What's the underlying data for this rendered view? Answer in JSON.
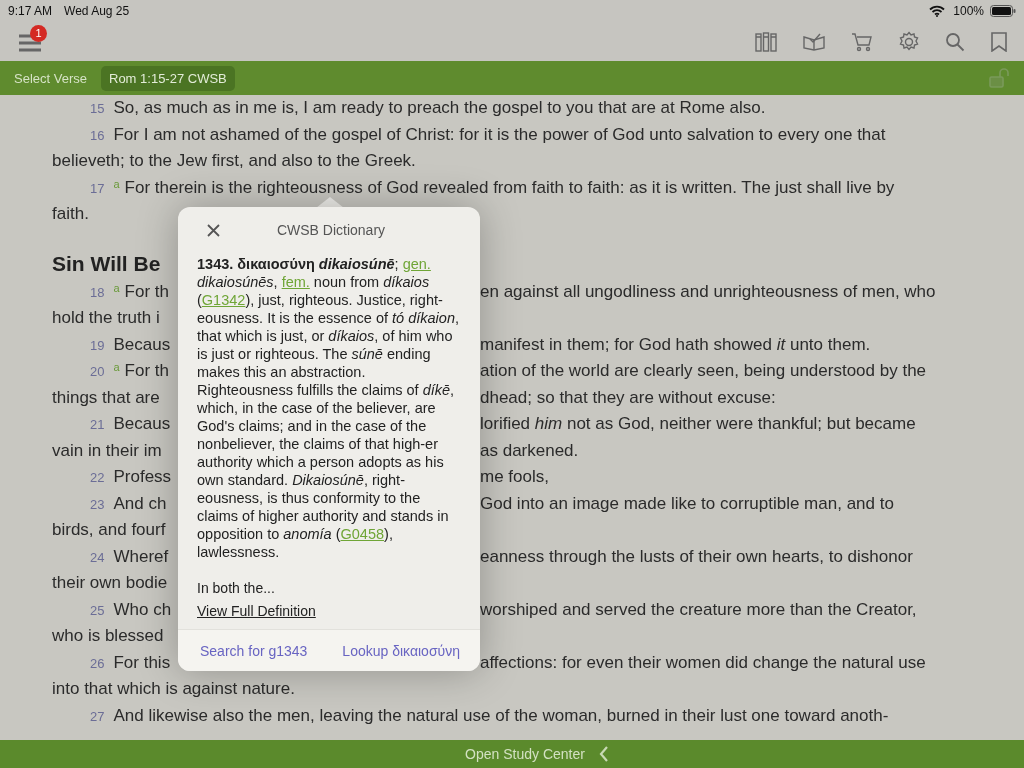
{
  "status_bar": {
    "time": "9:17 AM",
    "date": "Wed Aug 25",
    "battery": "100%"
  },
  "toolbar": {
    "menu_badge": "1"
  },
  "verse_bar": {
    "label": "Select Verse",
    "reference": "Rom 1:15-27 CWSB",
    "locked": false
  },
  "passage": [
    {
      "kind": "verse",
      "verse": "15",
      "text": "So, as much as in me is, I am ready to preach the gospel to you that are at Rome also."
    },
    {
      "kind": "verse",
      "verse": "16",
      "text": "For I am not ashamed of the gospel of Christ: for it is the power of God unto salvation to every one that"
    },
    {
      "kind": "cont",
      "text": "believeth; to the Jew first, and also to the Greek."
    },
    {
      "kind": "verse",
      "verse": "17",
      "note": "a",
      "text": "For therein is the righteousness of God revealed from faith to faith: as it is written. The just shall live by"
    },
    {
      "kind": "cont",
      "text": "faith."
    },
    {
      "kind": "heading",
      "text": "Sin Will Be"
    },
    {
      "kind": "verse",
      "verse": "18",
      "note": "a",
      "left": "For th",
      "right": "en against all ungodliness and unrighteousness of men, who"
    },
    {
      "kind": "cont",
      "left": "hold the truth i"
    },
    {
      "kind": "verse",
      "verse": "19",
      "left": "Becaus",
      "right": "manifest in them; for God hath showed *it* unto them."
    },
    {
      "kind": "verse",
      "verse": "20",
      "note": "a",
      "left": "For th",
      "right": "ation of the world are clearly seen, being understood by the"
    },
    {
      "kind": "cont",
      "left": "things that are",
      "right": "dhead; so that they are without excuse:"
    },
    {
      "kind": "verse",
      "verse": "21",
      "left": "Becaus",
      "right": "lorified *him* not as God, neither were thankful; but became"
    },
    {
      "kind": "cont",
      "left": "vain in their im",
      "right": "as darkened."
    },
    {
      "kind": "verse",
      "verse": "22",
      "left": "Profess",
      "right": "me fools,"
    },
    {
      "kind": "verse",
      "verse": "23",
      "left": "And ch",
      "right": "God into an image made like to corruptible man, and to"
    },
    {
      "kind": "cont",
      "left": "birds, and fourf"
    },
    {
      "kind": "verse",
      "verse": "24",
      "left": "Wheref",
      "right": "eanness through the lusts of their own hearts, to dishonor"
    },
    {
      "kind": "cont",
      "left": "their own bodie"
    },
    {
      "kind": "verse",
      "verse": "25",
      "left": "Who ch",
      "right": "worshiped and served the creature more than the Creator,"
    },
    {
      "kind": "cont",
      "left": "who is blessed"
    },
    {
      "kind": "verse",
      "verse": "26",
      "left": "For this",
      "right": "affections: for even their women did change the natural use"
    },
    {
      "kind": "cont",
      "text": "into that which is against nature."
    },
    {
      "kind": "verse",
      "verse": "27",
      "text": "And likewise also the men, leaving the natural use of the woman, burned in their lust one toward anoth-"
    }
  ],
  "popup": {
    "title": "CWSB Dictionary",
    "definition": [
      {
        "kind": "bold",
        "text": "1343. δικαιοσύνη "
      },
      {
        "kind": "bolditalic",
        "text": "dikaiosúnē"
      },
      {
        "kind": "text",
        "text": "; "
      },
      {
        "kind": "link",
        "text": "gen."
      },
      {
        "kind": "italic",
        "text": " dikaiosúnēs"
      },
      {
        "kind": "text",
        "text": ", "
      },
      {
        "kind": "link",
        "text": "fem."
      },
      {
        "kind": "text",
        "text": " noun from "
      },
      {
        "kind": "italic",
        "text": "díkaios"
      },
      {
        "kind": "text",
        "text": " ("
      },
      {
        "kind": "link",
        "text": "G1342"
      },
      {
        "kind": "text",
        "text": "), just, righteous. Justice, right-eousness. It is the essence of "
      },
      {
        "kind": "italic",
        "text": "tó díkaion"
      },
      {
        "kind": "text",
        "text": ", that which is just, or "
      },
      {
        "kind": "italic",
        "text": "díkaios"
      },
      {
        "kind": "text",
        "text": ", of him who is just or righteous. The "
      },
      {
        "kind": "italic",
        "text": "súnē"
      },
      {
        "kind": "text",
        "text": " ending makes this an abstraction. Righteousness fulfills the claims of "
      },
      {
        "kind": "italic",
        "text": "díkē"
      },
      {
        "kind": "text",
        "text": ", which, in the case of the believer, are God's claims; and in the case of the nonbeliever, the claims of that high-er authority which a person adopts as his own standard. "
      },
      {
        "kind": "italic",
        "text": "Dikaiosúnē"
      },
      {
        "kind": "text",
        "text": ", right-eousness, is thus conformity to the claims of higher authority and stands in opposition to "
      },
      {
        "kind": "italic",
        "text": "anomía"
      },
      {
        "kind": "text",
        "text": " ("
      },
      {
        "kind": "link",
        "text": "G0458"
      },
      {
        "kind": "text",
        "text": "), lawlessness."
      }
    ],
    "excerpt": "In both the...",
    "full_link": "View Full Definition",
    "actions": [
      "Search for g1343",
      "Lookup δικαιοσύνη"
    ]
  },
  "bottom_bar": {
    "label": "Open Study Center"
  }
}
